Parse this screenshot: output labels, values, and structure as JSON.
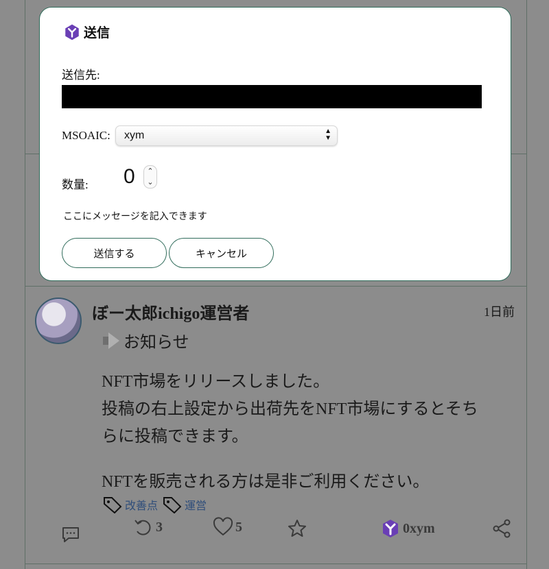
{
  "modal": {
    "title": "送信",
    "recipient_label": "送信先:",
    "mosaic_label": "MSOAIC:",
    "mosaic_selected": "xym",
    "quantity_label": "数量:",
    "quantity_value": "0",
    "message_placeholder": "ここにメッセージを記入できます",
    "send_label": "送信する",
    "cancel_label": "キャンセル",
    "brand_color": "#6a3fb5"
  },
  "post": {
    "author": "ぼー太郎ichigo運営者",
    "time": "1日前",
    "notice": "お知らせ",
    "lines_para1": [
      "NFT市場をリリースしました。",
      "投稿の右上設定から出荷先をNFT市場にするとそち",
      "らに投稿できます。"
    ],
    "line_para2": "NFTを販売される方は是非ご利用ください。",
    "tags": [
      "改善点",
      "運営"
    ],
    "actions": {
      "reply_count": "",
      "repost_count": "3",
      "like_count": "5",
      "tip_amount": "0xym"
    }
  }
}
